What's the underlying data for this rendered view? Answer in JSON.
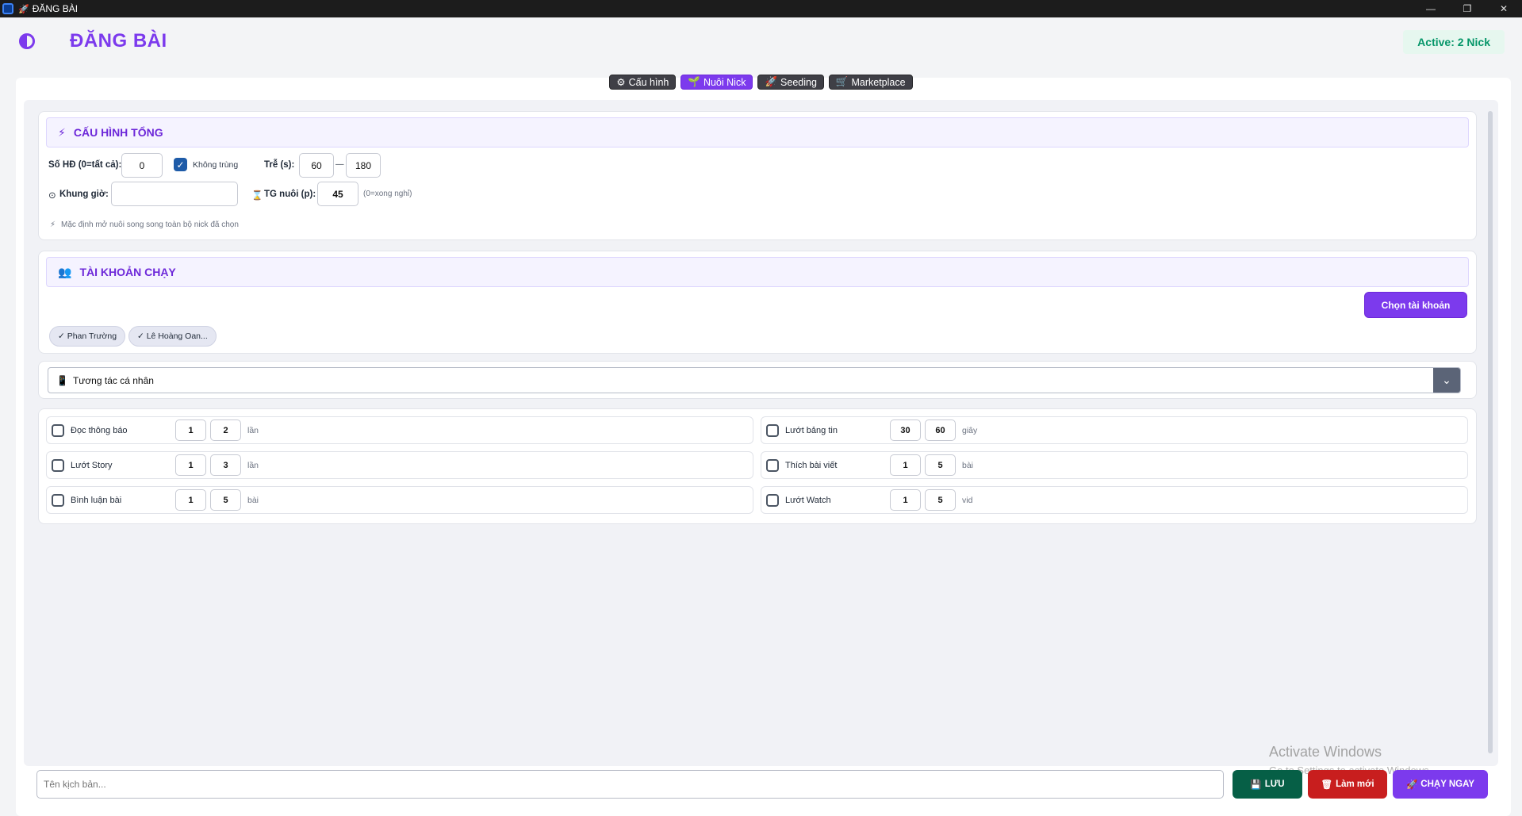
{
  "window": {
    "title": "ĐĂNG BÀI",
    "minimize": "—",
    "restore": "❐",
    "close": "✕"
  },
  "header": {
    "title": "ĐĂNG BÀI",
    "active_badge": "Active: 2 Nick"
  },
  "tabs": [
    {
      "icon": "⚙",
      "label": "Cấu hình"
    },
    {
      "icon": "🌱",
      "label": "Nuôi Nick"
    },
    {
      "icon": "🚀",
      "label": "Seeding"
    },
    {
      "icon": "🛒",
      "label": "Marketplace"
    }
  ],
  "config": {
    "title": "CẤU HÌNH TỔNG",
    "icon": "⚡",
    "so_hd_label": "Số HĐ (0=tất cả):",
    "so_hd_value": "0",
    "khong_trung_label": "Không trùng",
    "tre_label": "Trễ (s):",
    "tre_min": "60",
    "tre_sep": "—",
    "tre_max": "180",
    "khung_gio_label": "Khung giờ:",
    "khung_gio_icon": "⊙",
    "tg_nuoi_icon": "⌛",
    "tg_nuoi_label": "TG nuôi (p):",
    "tg_nuoi_value": "45",
    "tg_nuoi_hint": "(0=xong nghỉ)",
    "note_icon": "⚡",
    "note": "Mặc định mở nuôi song song toàn bộ nick đã chọn"
  },
  "accounts": {
    "title": "TÀI KHOẢN CHẠY",
    "icon": "👥",
    "choose_button": "Chọn tài khoản",
    "selected": [
      "✓ Phan Trường",
      "✓ Lê Hoàng Oan..."
    ]
  },
  "mode_select": {
    "icon": "📱",
    "value": "Tương tác cá nhân",
    "arrow": "⌄"
  },
  "options_left": [
    {
      "label": "Đọc thông báo",
      "min": "1",
      "max": "2",
      "unit": "lần"
    },
    {
      "label": "Lướt Story",
      "min": "1",
      "max": "3",
      "unit": "lần"
    },
    {
      "label": "Bình luận bài",
      "min": "1",
      "max": "5",
      "unit": "bài"
    }
  ],
  "options_right": [
    {
      "label": "Lướt bảng tin",
      "min": "30",
      "max": "60",
      "unit": "giây"
    },
    {
      "label": "Thích bài viết",
      "min": "1",
      "max": "5",
      "unit": "bài"
    },
    {
      "label": "Lướt Watch",
      "min": "1",
      "max": "5",
      "unit": "vid"
    }
  ],
  "bottom": {
    "script_placeholder": "Tên kịch bản...",
    "save_icon": "💾",
    "save_label": "LƯU",
    "reset_icon": "🗑",
    "reset_label": "Làm mới",
    "run_icon": "🚀",
    "run_label": "CHẠY NGAY"
  },
  "watermark": {
    "line1": "Activate Windows",
    "line2": "Go to Settings to activate Windows."
  },
  "colors": {
    "accent": "#7c3aed",
    "save": "#065f46",
    "reset": "#c81e1e",
    "active_text": "#059669"
  }
}
